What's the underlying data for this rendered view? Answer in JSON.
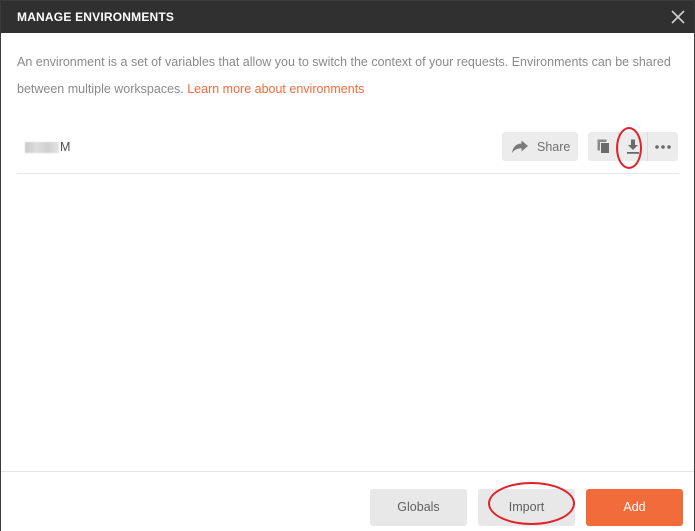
{
  "dialog": {
    "title": "MANAGE ENVIRONMENTS",
    "close_icon": "close-icon"
  },
  "intro": {
    "text": "An environment is a set of variables that allow you to switch the context of your requests. Environments can be shared between multiple workspaces.",
    "link_text": "Learn more about environments"
  },
  "environments": [
    {
      "name_suffix": "M",
      "share_label": "Share"
    }
  ],
  "footer": {
    "globals_label": "Globals",
    "import_label": "Import",
    "add_label": "Add"
  },
  "colors": {
    "accent": "#f26b3a",
    "titlebar": "#303030",
    "annotation": "#e0232b"
  }
}
